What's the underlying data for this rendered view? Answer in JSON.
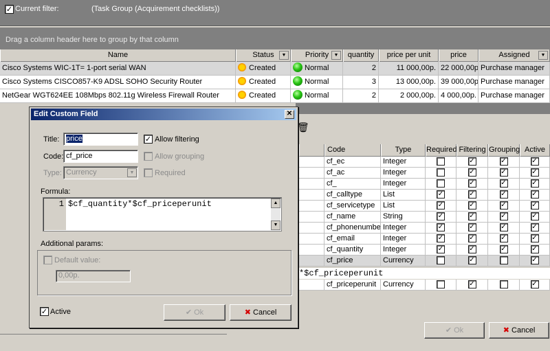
{
  "filter": {
    "label": "Current filter:",
    "value": "(Task Group  (Acquirement checklists))"
  },
  "group_hint": "Drag a column header here to group by that column",
  "grid": {
    "columns": [
      "Name",
      "Status",
      "Priority",
      "quantity",
      "price per unit",
      "price",
      "Assigned"
    ],
    "rows": [
      {
        "name": "Cisco Systems WIC-1T= 1-port serial WAN",
        "status": "Created",
        "priority": "Normal",
        "quantity": "2",
        "ppu": "11 000,00р.",
        "price": "22 000,00р.",
        "assigned": "Purchase manager"
      },
      {
        "name": "Cisco Systems CISCO857-K9 ADSL SOHO Security Router",
        "status": "Created",
        "priority": "Normal",
        "quantity": "3",
        "ppu": "13 000,00р.",
        "price": "39 000,00р.",
        "assigned": "Purchase manager"
      },
      {
        "name": "NetGear WGT624EE 108Mbps 802.11g Wireless Firewall Router",
        "status": "Created",
        "priority": "Normal",
        "quantity": "2",
        "ppu": "2 000,00р.",
        "price": "4 000,00р.",
        "assigned": "Purchase manager"
      }
    ]
  },
  "fields_table": {
    "columns": [
      "Code",
      "Type",
      "Required",
      "Filtering",
      "Grouping",
      "Active"
    ],
    "rows": [
      {
        "code": "cf_ec",
        "type": "Integer",
        "req": false,
        "filt": true,
        "grp": true,
        "act": true
      },
      {
        "code": "cf_ac",
        "type": "Integer",
        "req": false,
        "filt": true,
        "grp": true,
        "act": true
      },
      {
        "code": "cf_",
        "type": "Integer",
        "req": false,
        "filt": true,
        "grp": true,
        "act": true
      },
      {
        "code": "cf_calltype",
        "type": "List",
        "req": true,
        "filt": true,
        "grp": true,
        "act": true
      },
      {
        "code": "cf_servicetype",
        "type": "List",
        "req": true,
        "filt": true,
        "grp": true,
        "act": true
      },
      {
        "code": "cf_name",
        "type": "String",
        "req": true,
        "filt": true,
        "grp": true,
        "act": true
      },
      {
        "code": "cf_phonenumber",
        "type": "Integer",
        "req": true,
        "filt": true,
        "grp": true,
        "act": true
      },
      {
        "code": "cf_email",
        "type": "Integer",
        "req": true,
        "filt": true,
        "grp": true,
        "act": true
      },
      {
        "code": "cf_quantity",
        "type": "Integer",
        "req": true,
        "filt": true,
        "grp": true,
        "act": true
      },
      {
        "code": "cf_price",
        "type": "Currency",
        "req": false,
        "filt": true,
        "grp": false,
        "act": true
      }
    ],
    "formula_fragment": "*$cf_priceperunit",
    "last_row": {
      "code": "cf_priceperunit",
      "type": "Currency",
      "req": false,
      "filt": true,
      "grp": false,
      "act": true
    },
    "ok_label": "Ok",
    "cancel_label": "Cancel"
  },
  "dialog": {
    "title": "Edit Custom Field",
    "title_label": "Title:",
    "title_value": "price",
    "code_label": "Code:",
    "code_value": "cf_price",
    "type_label": "Type:",
    "type_value": "Currency",
    "allow_filtering": "Allow filtering",
    "allow_grouping": "Allow grouping",
    "required": "Required",
    "formula_label": "Formula:",
    "formula_line_no": "1",
    "formula": "$cf_quantity*$cf_priceperunit",
    "additional_params": "Additional params:",
    "default_value_label": "Default value:",
    "default_value": "0,00р.",
    "active_label": "Active",
    "ok_label": "Ok",
    "cancel_label": "Cancel"
  }
}
